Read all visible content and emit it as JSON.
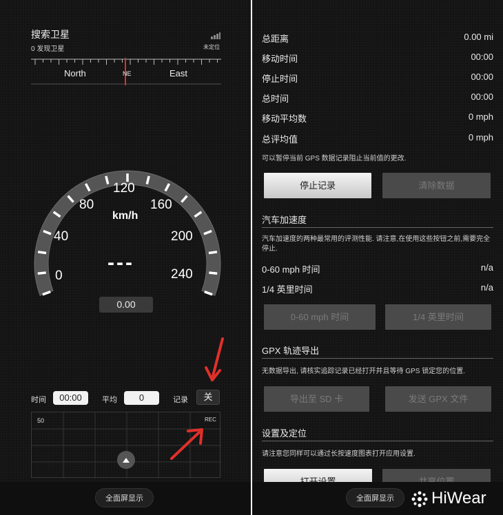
{
  "left": {
    "gps_title": "搜索卫星",
    "gps_sub": "0 发现卫星",
    "gps_status": "未定位",
    "compass": {
      "labels": [
        "North",
        "NE",
        "East"
      ]
    },
    "gauge": {
      "unit": "km/h",
      "ticks": [
        "0",
        "40",
        "80",
        "120",
        "160",
        "200",
        "240"
      ],
      "speed_display": "---",
      "odometer": "0.00"
    },
    "stats": {
      "time_label": "时间",
      "time_value": "00:00",
      "avg_label": "平均",
      "avg_value": "0",
      "rec_label": "记录",
      "rec_toggle": "关"
    },
    "graph": {
      "y_max": "50",
      "rec_tag": "REC"
    },
    "fullscreen": "全面屏显示"
  },
  "right": {
    "rows": [
      {
        "label": "总距离",
        "value": "0.00 mi"
      },
      {
        "label": "移动时间",
        "value": "00:00"
      },
      {
        "label": "停止时间",
        "value": "00:00"
      },
      {
        "label": "总时间",
        "value": "00:00"
      },
      {
        "label": "移动平均数",
        "value": "0 mph"
      },
      {
        "label": "总评均值",
        "value": "0 mph"
      }
    ],
    "pause_note": "可以暂停当前 GPS 数据记录阻止当前值的更改.",
    "stop_btn": "停止记录",
    "clear_btn": "清除数据",
    "accel": {
      "title": "汽车加速度",
      "desc": "汽车加速度的两种最常用的评测性能. 请注意,在使用这些按钮之前,需要完全停止.",
      "rows": [
        {
          "label": "0-60 mph 时间",
          "value": "n/a"
        },
        {
          "label": "1/4 英里时间",
          "value": "n/a"
        }
      ],
      "btn1": "0-60 mph 时间",
      "btn2": "1/4 英里时间"
    },
    "gpx": {
      "title": "GPX 轨迹导出",
      "desc": "无数据导出, 请核实追踪记录已经打开并且等待 GPS 锁定您的位置.",
      "btn1": "导出至 SD 卡",
      "btn2": "发送 GPX 文件"
    },
    "settings": {
      "title": "设置及定位",
      "desc": "请注意您同样可以通过长按速度图表打开应用设置.",
      "btn1": "打开设置",
      "btn2": "共享位置"
    },
    "fullscreen": "全面屏显示",
    "watermark": "HiWear"
  },
  "colors": {
    "accent_red": "#e0302a",
    "background": "#141414"
  }
}
